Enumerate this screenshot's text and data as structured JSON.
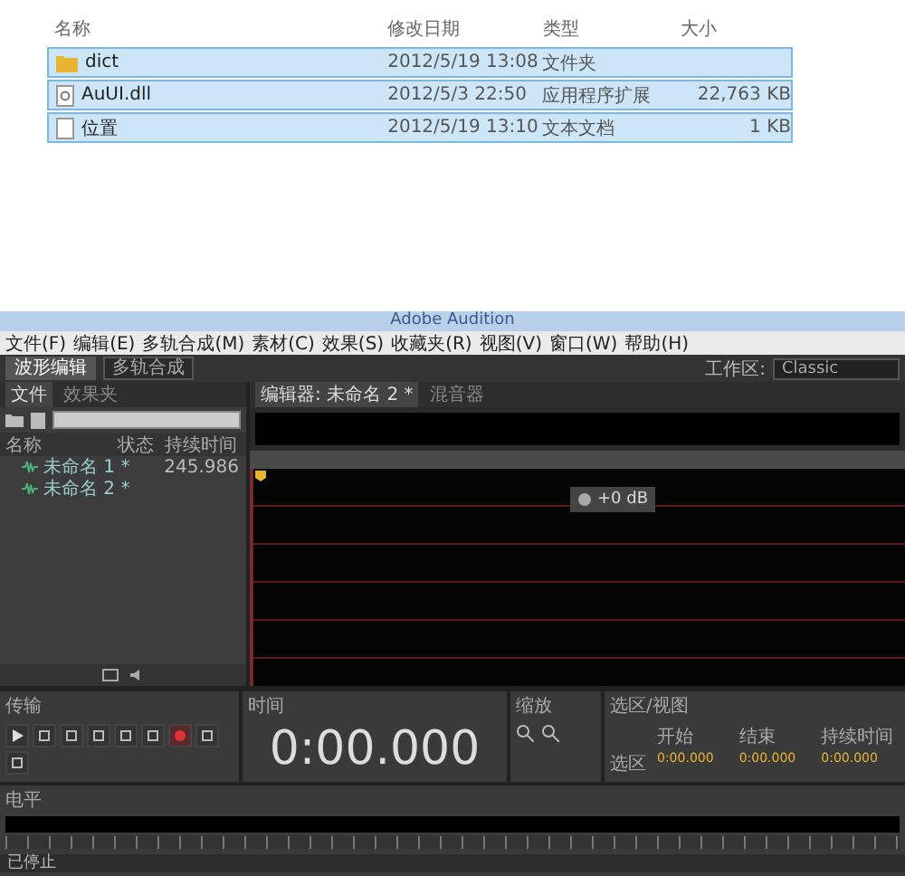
{
  "explorer": {
    "columns": [
      "名称",
      "修改日期",
      "类型",
      "大小"
    ],
    "rows": [
      {
        "kind": "folder",
        "name": "dict",
        "date": "2012/5/19 13:08",
        "type": "文件夹",
        "selected": true
      },
      {
        "kind": "dll",
        "name": "AuUI.dll",
        "date": "2012/5/3 22:50",
        "type": "应用程序扩展",
        "size": "22,763 KB",
        "selected": true
      },
      {
        "kind": "text",
        "name": "位置",
        "date": "2012/5/19 13:10",
        "type": "文本文档",
        "size": "1 KB",
        "selected": true
      }
    ]
  },
  "audition": {
    "title": "Adobe Audition",
    "menu": [
      "文件(F)",
      "编辑(E)",
      "多轨合成(M)",
      "素材(C)",
      "效果(S)",
      "收藏夹(R)",
      "视图(V)",
      "窗口(W)",
      "帮助(H)"
    ],
    "views": [
      {
        "label": "波形编辑",
        "selected": true
      },
      {
        "label": "多轨合成",
        "selected": false
      }
    ],
    "workspace": {
      "label": "工作区:",
      "value": "Classic"
    },
    "files_panel": {
      "tabs": [
        {
          "label": "文件",
          "selected": true
        },
        {
          "label": "效果夹",
          "selected": false
        }
      ],
      "columns": [
        "名称",
        "状态",
        "持续时间"
      ],
      "rows": [
        {
          "name": "未命名 1 *",
          "duration": "245.986"
        },
        {
          "name": "未命名 2 *"
        }
      ]
    },
    "editor_tabs": [
      {
        "label": "编辑器: 未命名 2 *",
        "selected": true
      },
      {
        "label": "混音器",
        "selected": false
      }
    ],
    "hud_reading": "+0 dB",
    "transport": {
      "title": "传输"
    },
    "time": {
      "title": "时间",
      "value": "0:00.000"
    },
    "zoom": {
      "title": "缩放"
    },
    "selection": {
      "title": "选区/视图",
      "columns": [
        "开始",
        "结束",
        "持续时间"
      ],
      "rows": [
        {
          "label": "选区",
          "values": [
            "0:00.000",
            "0:00.000",
            "0:00.000"
          ]
        }
      ]
    },
    "levels": {
      "title": "电平"
    },
    "status": "已停止"
  }
}
